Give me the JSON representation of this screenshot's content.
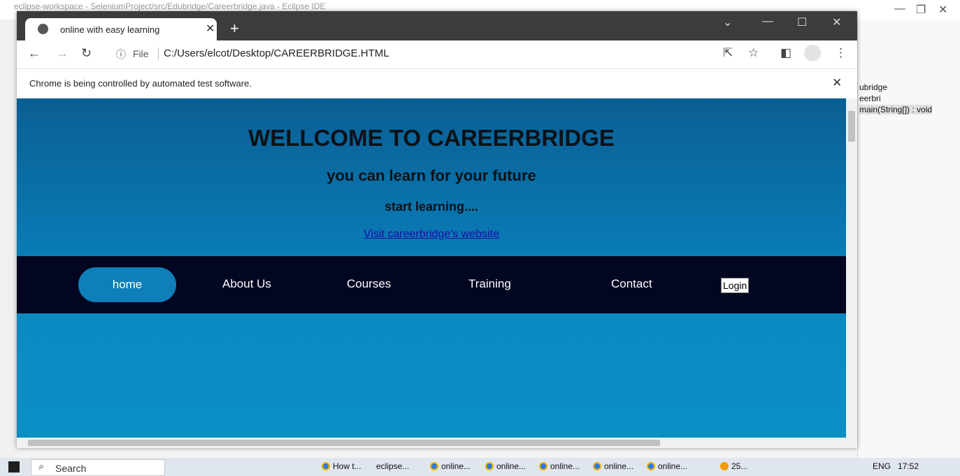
{
  "eclipse": {
    "title": "eclipse-workspace - SeleniumProject/src/Edubridge/Careerbridge.java - Eclipse IDE",
    "outline": [
      "ubridge",
      "eerbri",
      "main(String[]) : void"
    ]
  },
  "chrome": {
    "tab_title": "online with easy learning",
    "address": "C:/Users/elcot/Desktop/CAREERBRIDGE.HTML",
    "file_label": "File",
    "infobar": "Chrome is being controlled by automated test software."
  },
  "page": {
    "heading": "WELLCOME TO CAREERBRIDGE",
    "subheading": "you can learn for your future",
    "tagline": "start learning....",
    "link": "Visit careerbridge's website",
    "nav": [
      "home",
      "About Us",
      "Courses",
      "Training",
      "Contact"
    ],
    "login": "Login"
  },
  "taskbar": {
    "search": "Search",
    "apps": [
      "How t...",
      "eclipse...",
      "online...",
      "online...",
      "online...",
      "online...",
      "online...",
      "25..."
    ],
    "lang": "ENG",
    "time": "17:52"
  },
  "colors": {
    "hero": "#0a6fa8",
    "nav_bg": "#020621",
    "home_pill": "#0f7fb8",
    "link": "#1a0dab"
  }
}
